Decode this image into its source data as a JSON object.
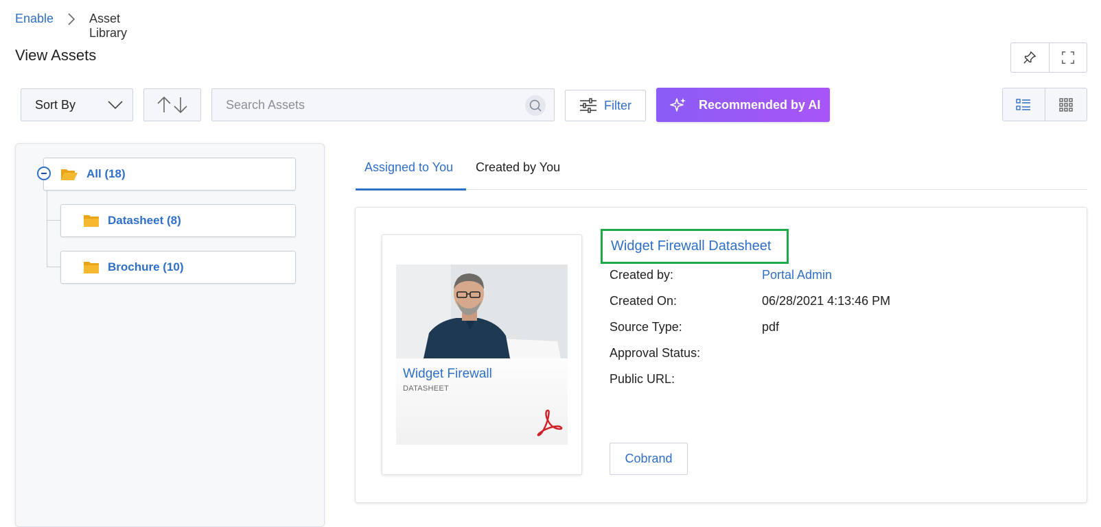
{
  "breadcrumb": {
    "root": "Enable",
    "current": "Asset Library"
  },
  "page": {
    "title": "View Assets"
  },
  "toolbar": {
    "sort_label": "Sort By",
    "search_placeholder": "Search Assets",
    "filter_label": "Filter",
    "ai_label": "Recommended by AI"
  },
  "folders": {
    "all": "All (18)",
    "items": [
      "Datasheet (8)",
      "Brochure (10)"
    ]
  },
  "tabs": [
    "Assigned to You",
    "Created by You"
  ],
  "asset": {
    "title": "Widget Firewall Datasheet",
    "thumbnail_title": "Widget Firewall",
    "thumbnail_type": "DATASHEET",
    "fields": [
      {
        "label": "Created by:",
        "value": "Portal Admin",
        "link": true
      },
      {
        "label": "Created On:",
        "value": "06/28/2021 4:13:46 PM"
      },
      {
        "label": "Source Type:",
        "value": "pdf"
      },
      {
        "label": "Approval Status:",
        "value": ""
      },
      {
        "label": "Public URL:",
        "value": ""
      }
    ],
    "cobrand_label": "Cobrand"
  },
  "colors": {
    "accent": "#2f6fc7",
    "ai_gradient_start": "#8b5cf6",
    "ai_gradient_end": "#a855f7",
    "highlight": "#20a84a",
    "folder": "#f5b82e"
  },
  "icons": [
    "chevron-right-icon",
    "pin-icon",
    "fullscreen-icon",
    "chevron-down-icon",
    "sort-arrows-icon",
    "search-icon",
    "filter-sliders-icon",
    "sparkle-icon",
    "list-view-icon",
    "grid-view-icon",
    "folder-open-icon",
    "folder-icon",
    "pdf-icon"
  ]
}
